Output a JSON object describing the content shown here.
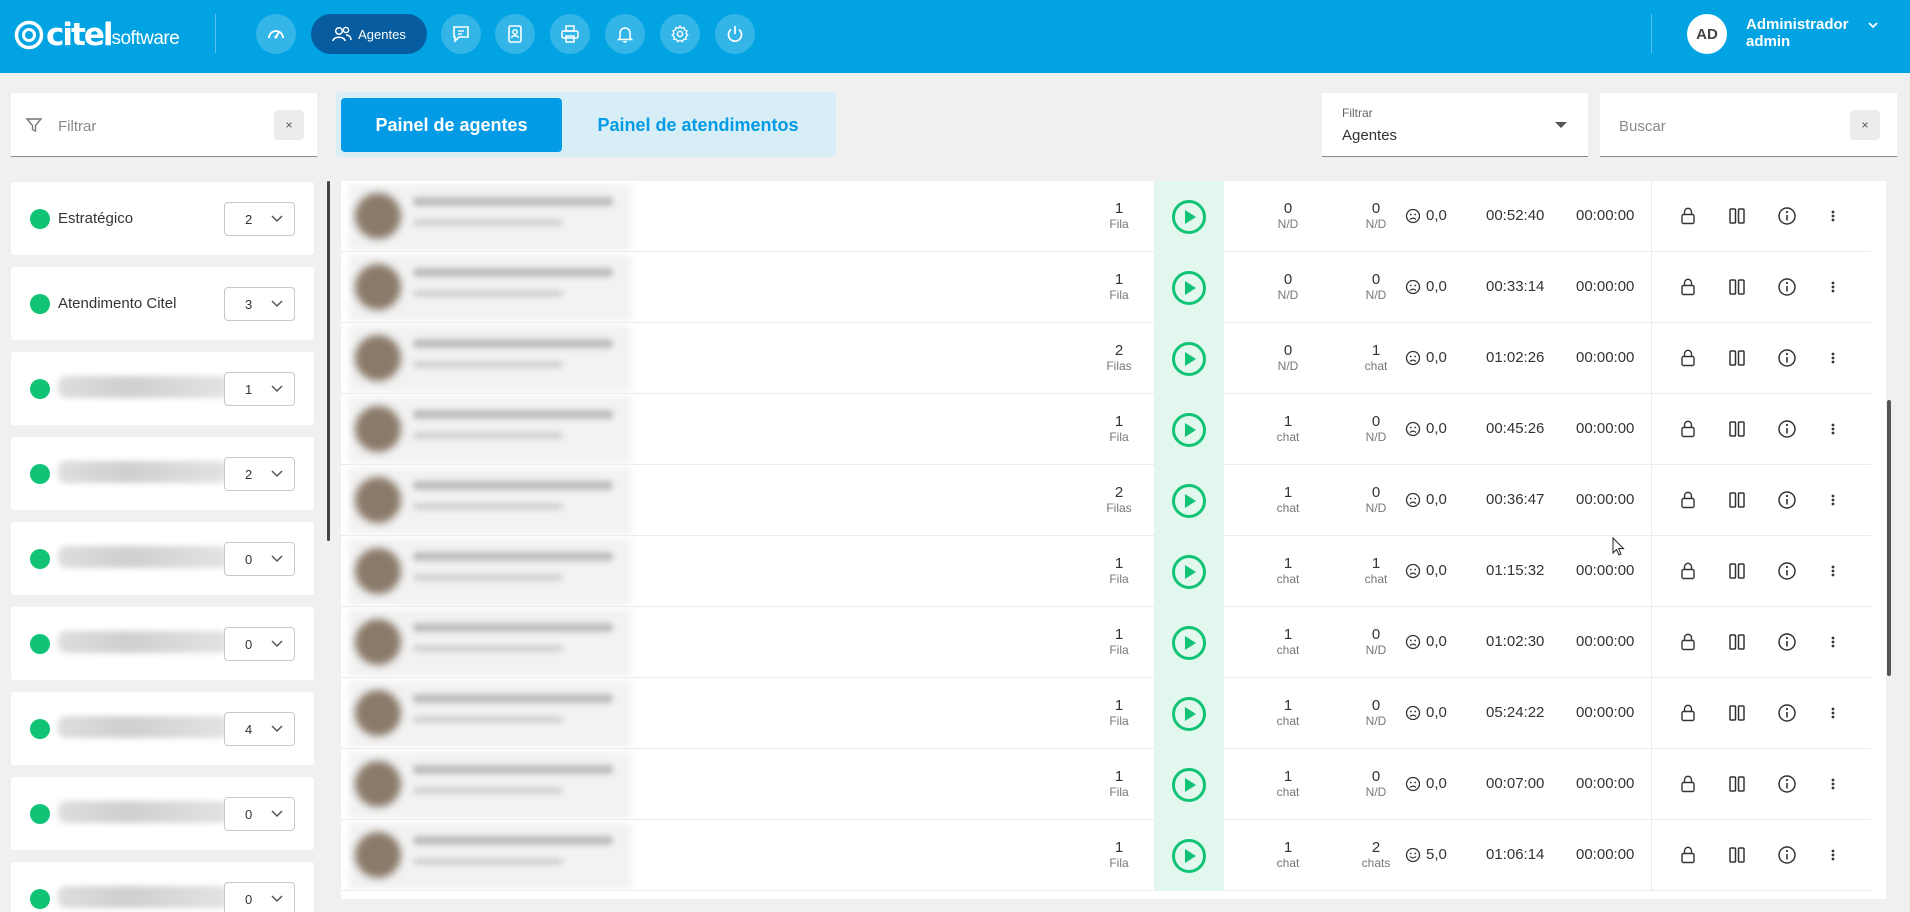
{
  "app": {
    "logo_text": "citel",
    "logo_sub": "software"
  },
  "nav": {
    "items": [
      {
        "name": "dashboard-icon",
        "label": ""
      },
      {
        "name": "agents-icon",
        "label": "Agentes",
        "active": true
      },
      {
        "name": "chat-icon",
        "label": ""
      },
      {
        "name": "contacts-icon",
        "label": ""
      },
      {
        "name": "printer-icon",
        "label": ""
      },
      {
        "name": "bell-icon",
        "label": ""
      },
      {
        "name": "gear-icon",
        "label": ""
      },
      {
        "name": "power-icon",
        "label": ""
      }
    ]
  },
  "user": {
    "initials": "AD",
    "name": "Administrador",
    "login": "admin"
  },
  "sidebar": {
    "filter_placeholder": "Filtrar",
    "clear_label": "×",
    "groups": [
      {
        "name": "Estratégico",
        "count": "2"
      },
      {
        "name": "Atendimento Citel",
        "count": "3"
      },
      {
        "name": "",
        "count": "1"
      },
      {
        "name": "",
        "count": "2"
      },
      {
        "name": "",
        "count": "0"
      },
      {
        "name": "",
        "count": "0"
      },
      {
        "name": "",
        "count": "4"
      },
      {
        "name": "",
        "count": "0"
      },
      {
        "name": "",
        "count": "0"
      }
    ]
  },
  "tabs": {
    "agents": "Painel de agentes",
    "attendances": "Painel de atendimentos"
  },
  "filter_select": {
    "label": "Filtrar",
    "value": "Agentes"
  },
  "search": {
    "placeholder": "Buscar",
    "clear_label": "×"
  },
  "agents": [
    {
      "queues": "1",
      "queues_label": "Fila",
      "c1": "0",
      "c1_label": "N/D",
      "c2": "0",
      "c2_label": "N/D",
      "score": "0,0",
      "mood": "sad",
      "t1": "00:52:40",
      "t2": "00:00:00"
    },
    {
      "queues": "1",
      "queues_label": "Fila",
      "c1": "0",
      "c1_label": "N/D",
      "c2": "0",
      "c2_label": "N/D",
      "score": "0,0",
      "mood": "sad",
      "t1": "00:33:14",
      "t2": "00:00:00"
    },
    {
      "queues": "2",
      "queues_label": "Filas",
      "c1": "0",
      "c1_label": "N/D",
      "c2": "1",
      "c2_label": "chat",
      "score": "0,0",
      "mood": "sad",
      "t1": "01:02:26",
      "t2": "00:00:00"
    },
    {
      "queues": "1",
      "queues_label": "Fila",
      "c1": "1",
      "c1_label": "chat",
      "c2": "0",
      "c2_label": "N/D",
      "score": "0,0",
      "mood": "sad",
      "t1": "00:45:26",
      "t2": "00:00:00"
    },
    {
      "queues": "2",
      "queues_label": "Filas",
      "c1": "1",
      "c1_label": "chat",
      "c2": "0",
      "c2_label": "N/D",
      "score": "0,0",
      "mood": "sad",
      "t1": "00:36:47",
      "t2": "00:00:00"
    },
    {
      "queues": "1",
      "queues_label": "Fila",
      "c1": "1",
      "c1_label": "chat",
      "c2": "1",
      "c2_label": "chat",
      "score": "0,0",
      "mood": "sad",
      "t1": "01:15:32",
      "t2": "00:00:00"
    },
    {
      "queues": "1",
      "queues_label": "Fila",
      "c1": "1",
      "c1_label": "chat",
      "c2": "0",
      "c2_label": "N/D",
      "score": "0,0",
      "mood": "sad",
      "t1": "01:02:30",
      "t2": "00:00:00"
    },
    {
      "queues": "1",
      "queues_label": "Fila",
      "c1": "1",
      "c1_label": "chat",
      "c2": "0",
      "c2_label": "N/D",
      "score": "0,0",
      "mood": "sad",
      "t1": "05:24:22",
      "t2": "00:00:00"
    },
    {
      "queues": "1",
      "queues_label": "Fila",
      "c1": "1",
      "c1_label": "chat",
      "c2": "0",
      "c2_label": "N/D",
      "score": "0,0",
      "mood": "sad",
      "t1": "00:07:00",
      "t2": "00:00:00"
    },
    {
      "queues": "1",
      "queues_label": "Fila",
      "c1": "1",
      "c1_label": "chat",
      "c2": "2",
      "c2_label": "chats",
      "score": "5,0",
      "mood": "happy",
      "t1": "01:06:14",
      "t2": "00:00:00"
    }
  ],
  "colors": {
    "topbar": "#02a3e3",
    "active_nav": "#065c9e",
    "online": "#11c375",
    "play": "#11c375",
    "play_bg": "#e2f7ee",
    "tab_active": "#039be5"
  }
}
